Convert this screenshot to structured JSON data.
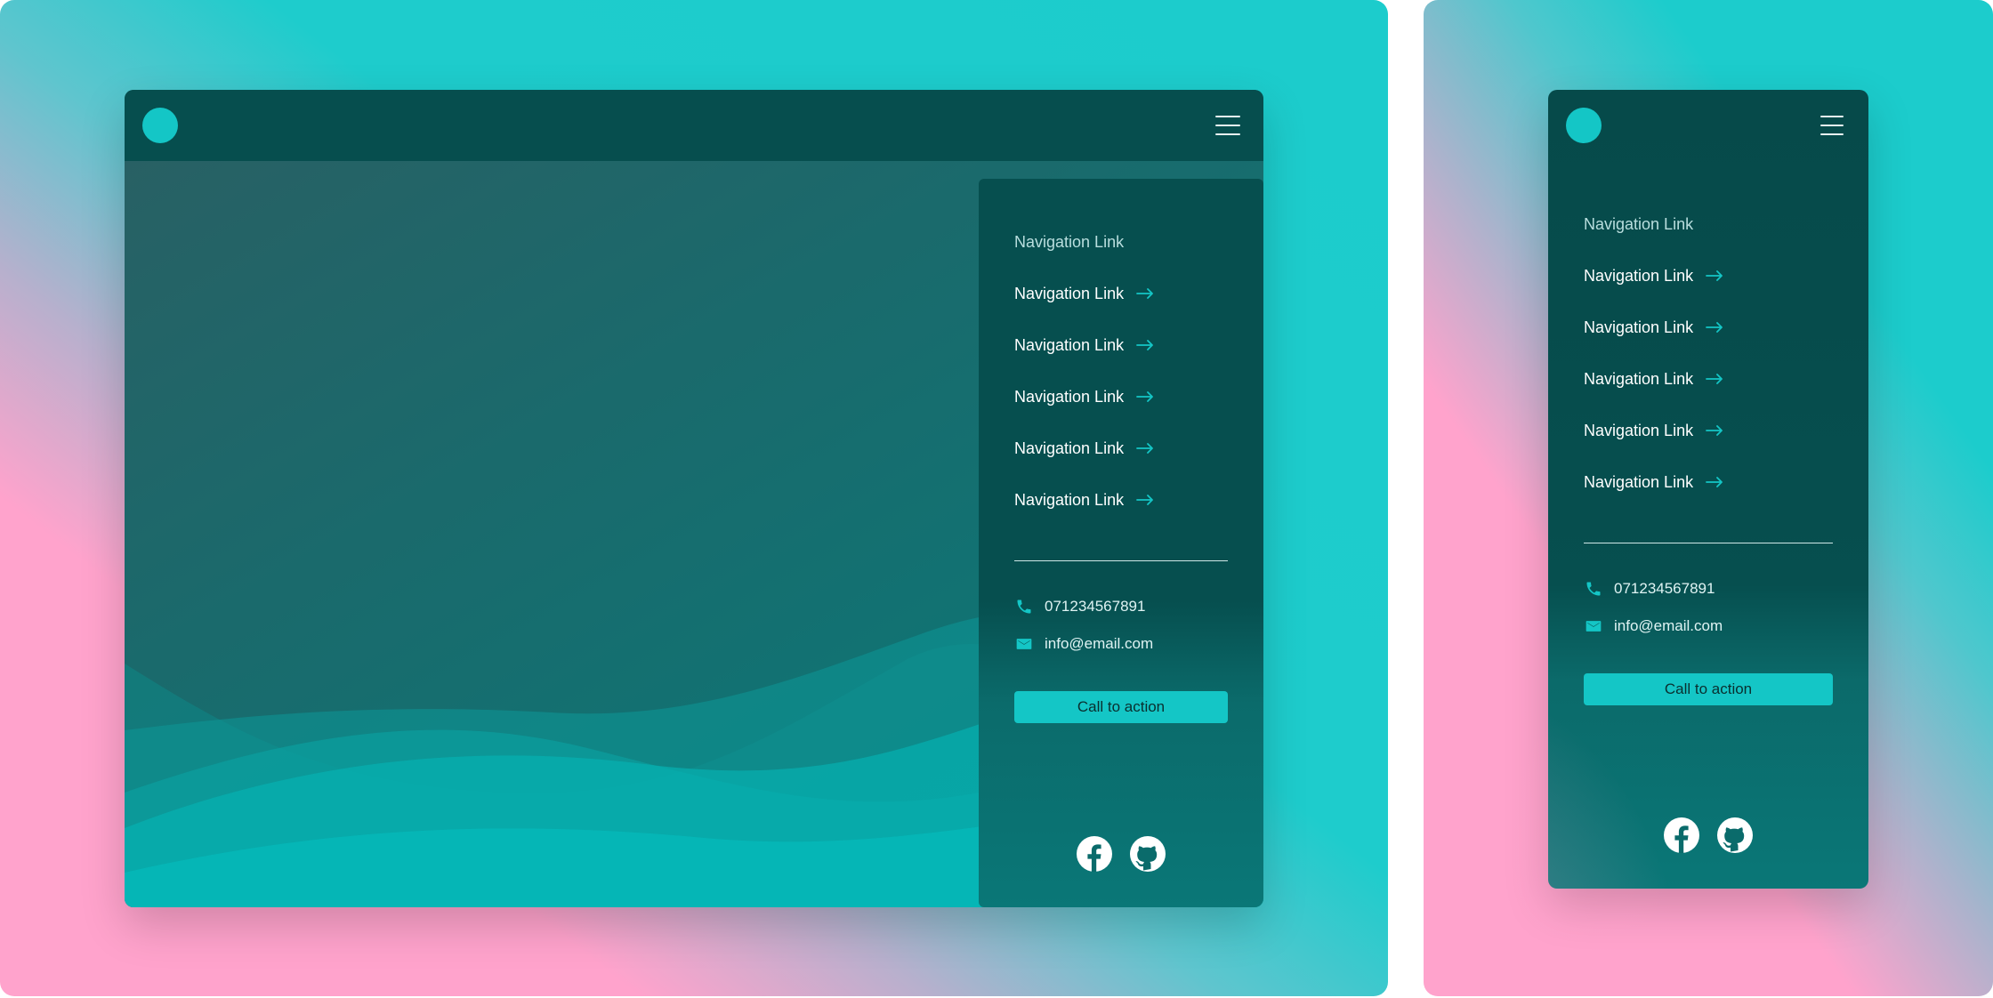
{
  "colors": {
    "accent": "#14c6c6",
    "header_bg": "#064e4e",
    "menu_bg": "#064f4f",
    "pink": "#ffa3cc",
    "teal": "#1ccccc"
  },
  "desktop": {
    "menu": {
      "links": [
        "Navigation Link",
        "Navigation Link",
        "Navigation Link",
        "Navigation Link",
        "Navigation Link",
        "Navigation Link"
      ],
      "phone": "07123456789\u00031",
      "email": "info@email.com",
      "cta": "Call to action"
    }
  },
  "mobile": {
    "menu": {
      "links": [
        "Navigation Link",
        "Navigation Link",
        "Navigation Link",
        "Navigation Link",
        "Navigation Link",
        "Navigation Link"
      ],
      "phone": "071234567891",
      "email": "info@email.com",
      "cta": "Call to action"
    }
  },
  "icons": {
    "logo": "circle-logo",
    "menu": "hamburger-icon",
    "arrow": "arrow-right-icon",
    "phone": "phone-icon",
    "email": "envelope-icon",
    "social": [
      "facebook-icon",
      "github-icon"
    ]
  }
}
